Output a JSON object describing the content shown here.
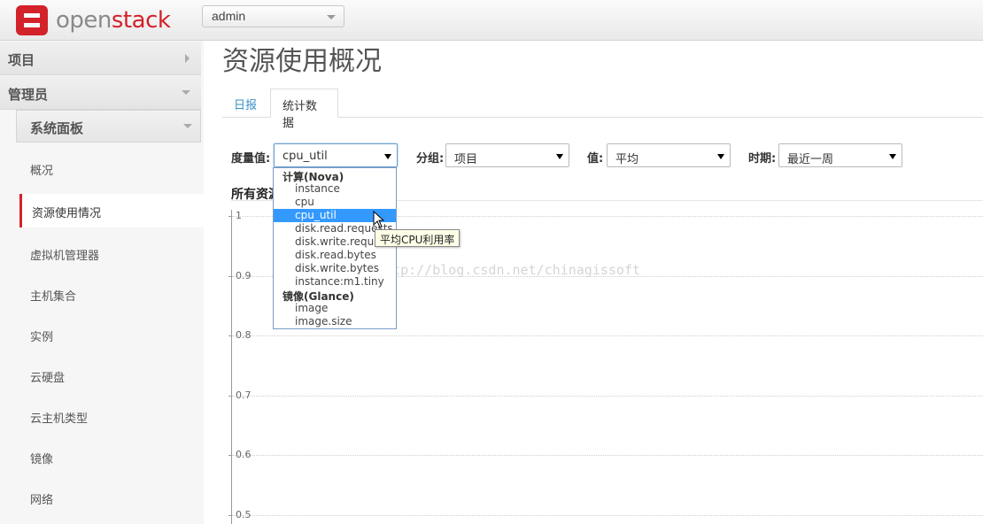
{
  "header": {
    "logo_open": "open",
    "logo_stack": "stack",
    "project_selector": "admin"
  },
  "sidebar": {
    "sections": [
      {
        "label": "项目"
      },
      {
        "label": "管理员"
      }
    ],
    "subsection": "系统面板",
    "items": [
      {
        "label": "概况"
      },
      {
        "label": "资源使用情况"
      },
      {
        "label": "虚拟机管理器"
      },
      {
        "label": "主机集合"
      },
      {
        "label": "实例"
      },
      {
        "label": "云硬盘"
      },
      {
        "label": "云主机类型"
      },
      {
        "label": "镜像"
      },
      {
        "label": "网络"
      }
    ]
  },
  "main": {
    "title": "资源使用概况",
    "tabs": [
      {
        "label": "日报"
      },
      {
        "label": "统计数据"
      }
    ],
    "filters": {
      "metric_label": "度量值:",
      "metric_value": "cpu_util",
      "group_label": "分组:",
      "group_value": "项目",
      "value_label": "值:",
      "value_value": "平均",
      "period_label": "时期:",
      "period_value": "最近一周"
    },
    "section_heading": "所有资源",
    "dropdown": {
      "groups": [
        {
          "label": "计算(Nova)"
        },
        {
          "label": "镜像(Glance)"
        }
      ],
      "options": [
        {
          "label": "instance"
        },
        {
          "label": "cpu"
        },
        {
          "label": "cpu_util"
        },
        {
          "label": "disk.read.requests"
        },
        {
          "label": "disk.write.requests"
        },
        {
          "label": "disk.read.bytes"
        },
        {
          "label": "disk.write.bytes"
        },
        {
          "label": "instance:m1.tiny"
        },
        {
          "label": "image"
        },
        {
          "label": "image.size"
        }
      ],
      "selected": "cpu_util"
    },
    "tooltip": "平均CPU利用率",
    "watermark": "http://blog.csdn.net/chinagissoft"
  },
  "chart_data": {
    "type": "line",
    "yticks": [
      "1",
      "0.9",
      "0.8",
      "0.7",
      "0.6",
      "0.5"
    ],
    "ylim": [
      0.5,
      1
    ],
    "grid": true,
    "series": []
  },
  "colors": {
    "brand_red": "#d3222a",
    "link_blue": "#3a8fc7",
    "selected_option": "#3399ff"
  }
}
